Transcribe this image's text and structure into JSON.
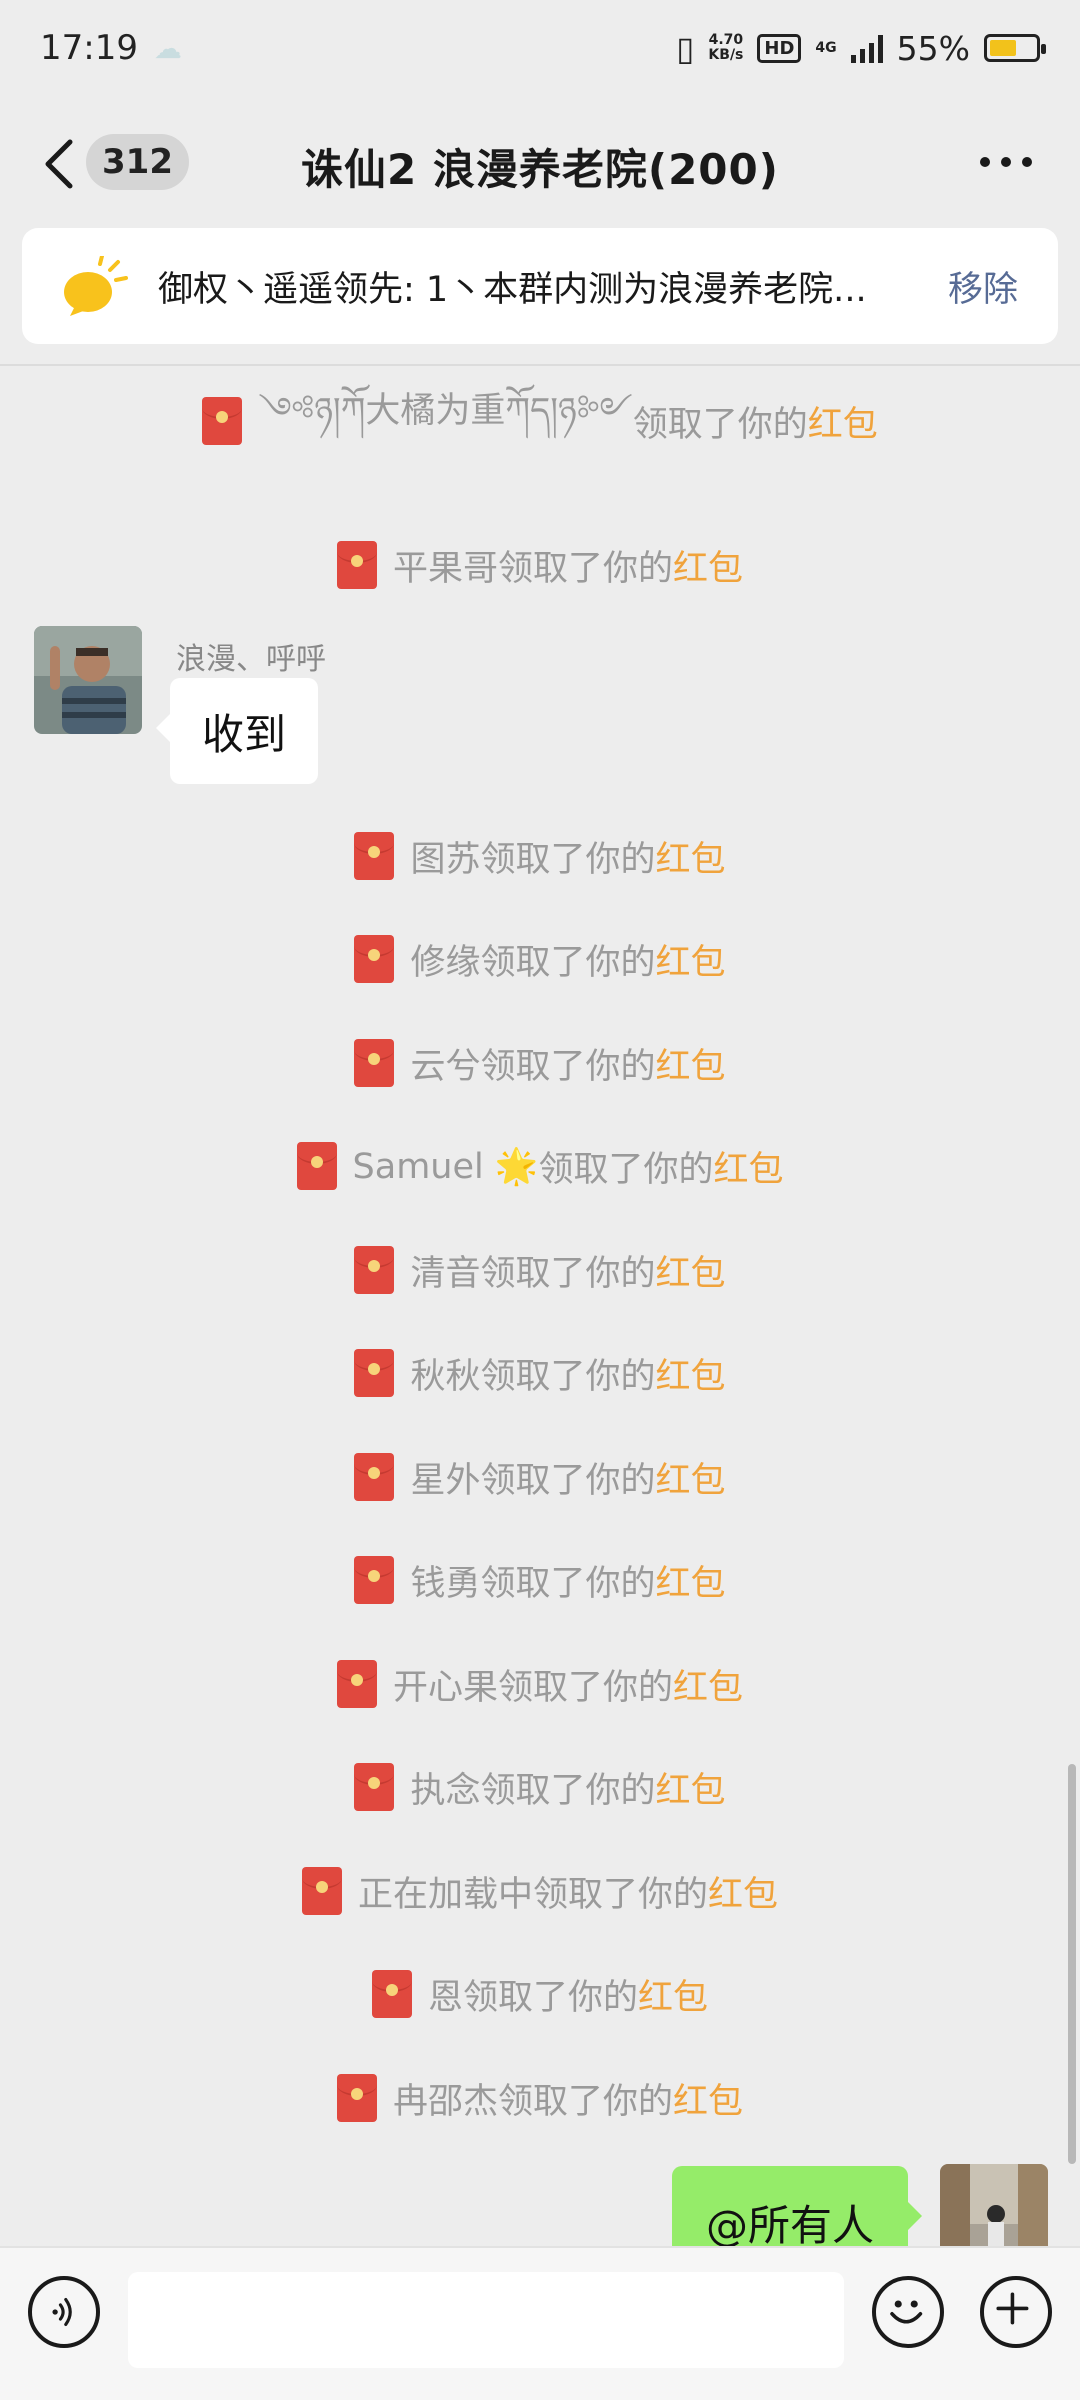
{
  "status_bar": {
    "time": "17:19",
    "net_speed_value": "4.70",
    "net_speed_unit": "KB/s",
    "hd": "HD",
    "network": "4G",
    "battery": "55%"
  },
  "nav": {
    "unread_count": "312",
    "title": "诛仙2  浪漫养老院(200)"
  },
  "notice": {
    "text": "御权丶遥遥领先: 1丶本群内测为浪漫养老院...",
    "remove_label": "移除"
  },
  "messages": {
    "sys_suffix": "领取了你的",
    "hongbao": "红包",
    "claims": [
      "༺ཉ།ཀོ大橘为重ཀོད།ཉ༻",
      "平果哥",
      "图苏",
      "修缘",
      "云兮",
      "Samuel 🌟",
      "清音",
      "秋秋",
      "星外",
      "钱勇",
      "开心果",
      "执念",
      "正在加载中",
      "恩",
      "冉邵杰"
    ],
    "incoming": {
      "sender": "浪漫、呼呼",
      "text": "收到"
    },
    "outgoing": {
      "text": "@所有人"
    }
  }
}
